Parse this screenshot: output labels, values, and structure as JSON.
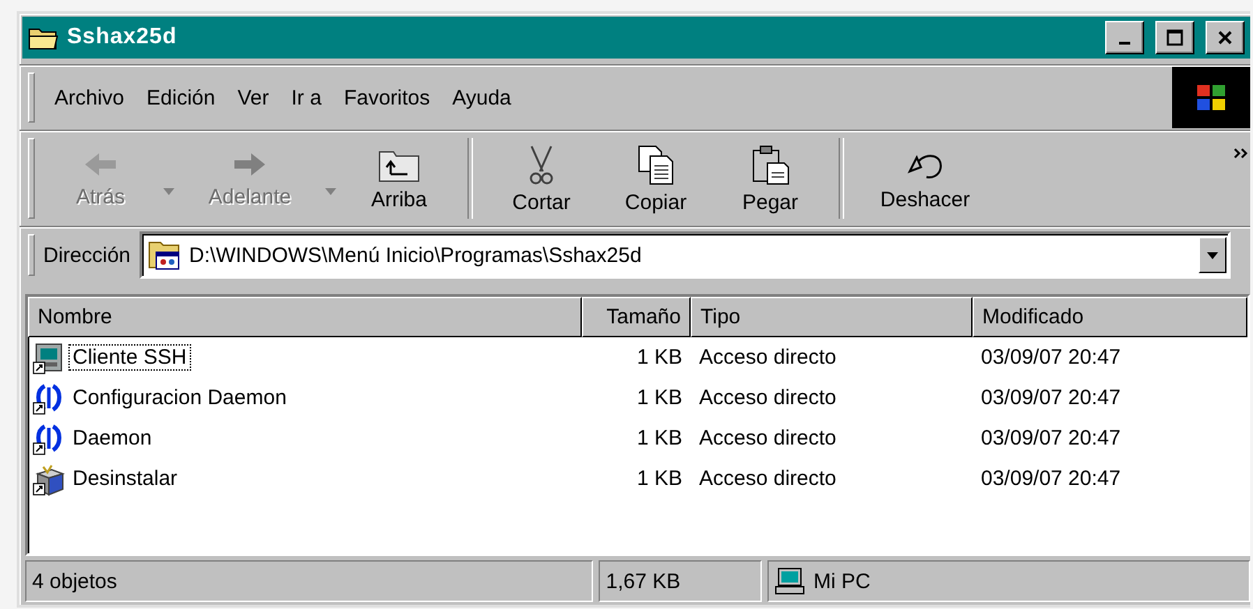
{
  "window": {
    "title": "Sshax25d"
  },
  "menu": [
    {
      "label": "Archivo"
    },
    {
      "label": "Edición"
    },
    {
      "label": "Ver"
    },
    {
      "label": "Ir a"
    },
    {
      "label": "Favoritos"
    },
    {
      "label": "Ayuda"
    }
  ],
  "toolbar": [
    {
      "kind": "back",
      "label": "Atrás",
      "disabled": true,
      "dropdown": true
    },
    {
      "kind": "forward",
      "label": "Adelante",
      "disabled": true,
      "dropdown": true
    },
    {
      "kind": "up",
      "label": "Arriba",
      "disabled": false,
      "dropdown": false
    },
    {
      "kind": "separator"
    },
    {
      "kind": "cut",
      "label": "Cortar",
      "disabled": false,
      "dropdown": false
    },
    {
      "kind": "copy",
      "label": "Copiar",
      "disabled": false,
      "dropdown": false
    },
    {
      "kind": "paste",
      "label": "Pegar",
      "disabled": false,
      "dropdown": false
    },
    {
      "kind": "separator"
    },
    {
      "kind": "undo",
      "label": "Deshacer",
      "disabled": false,
      "dropdown": false
    }
  ],
  "address": {
    "label": "Dirección",
    "value": "D:\\WINDOWS\\Menú Inicio\\Programas\\Sshax25d"
  },
  "table": {
    "columns": [
      "Nombre",
      "Tamaño",
      "Tipo",
      "Modificado"
    ],
    "rows": [
      {
        "kind": "terminal",
        "name": "Cliente SSH",
        "size": "1 KB",
        "type": "Acceso directo",
        "modified": "03/09/07 20:47",
        "focused": true,
        "selected": false
      },
      {
        "kind": "daemon",
        "name": "Configuracion Daemon",
        "size": "1 KB",
        "type": "Acceso directo",
        "modified": "03/09/07 20:47",
        "focused": false,
        "selected": false
      },
      {
        "kind": "daemon",
        "name": "Daemon",
        "size": "1 KB",
        "type": "Acceso directo",
        "modified": "03/09/07 20:47",
        "focused": false,
        "selected": false
      },
      {
        "kind": "uninstall",
        "name": "Desinstalar",
        "size": "1 KB",
        "type": "Acceso directo",
        "modified": "03/09/07 20:47",
        "focused": false,
        "selected": false
      }
    ]
  },
  "status_bar": {
    "count": "4 objetos",
    "size": "1,67 KB",
    "zone": "Mi PC"
  }
}
